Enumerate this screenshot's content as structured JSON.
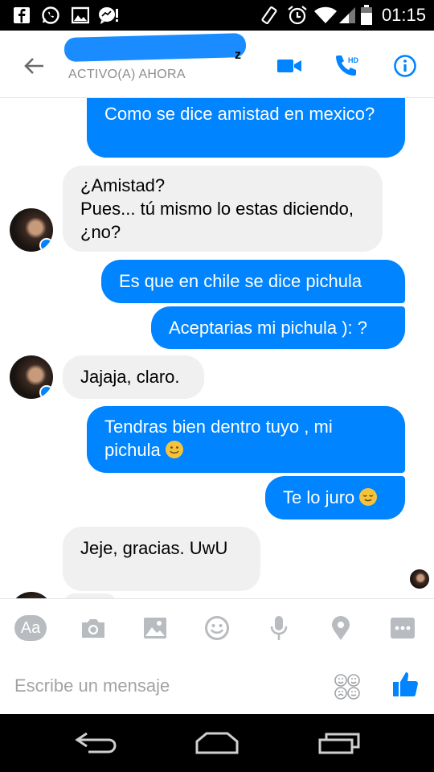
{
  "status_bar": {
    "time": "01:15",
    "left_icons": [
      "facebook-icon",
      "whatsapp-icon",
      "gallery-icon",
      "messenger-notification-icon"
    ],
    "right_icons": [
      "vibrate-icon",
      "alarm-icon",
      "wifi-icon",
      "signal-icon",
      "battery-icon"
    ]
  },
  "header": {
    "contact_name_suffix": "z",
    "status": "ACTIVO(A) AHORA",
    "accent_color": "#0084ff"
  },
  "messages": [
    {
      "side": "out",
      "text": "Como se dice amistad en mexico?"
    },
    {
      "side": "in",
      "text": "¿Amistad?\nPues... tú mismo lo estas diciendo, ¿no?"
    },
    {
      "side": "out",
      "text": "Es que en chile se dice pichula"
    },
    {
      "side": "out",
      "text": "Aceptarias mi pichula ): ?"
    },
    {
      "side": "in",
      "text": "Jajaja, claro."
    },
    {
      "side": "out",
      "text": "Tendras bien dentro tuyo  , mi pichula",
      "emoji": "slight-smile-emoji"
    },
    {
      "side": "out",
      "text": "Te lo juro",
      "emoji": "relieved-smile-emoji"
    },
    {
      "side": "in",
      "text": "Jeje, gracias. UwU"
    }
  ],
  "toolbar": {
    "aa_label": "Aa",
    "icons": [
      "aa-icon",
      "camera-icon",
      "image-icon",
      "sticker-icon",
      "microphone-icon",
      "location-icon",
      "more-icon"
    ]
  },
  "composer": {
    "placeholder": "Escribe un mensaje"
  },
  "nav": {
    "icons": [
      "back-nav-icon",
      "home-nav-icon",
      "recents-nav-icon"
    ]
  }
}
